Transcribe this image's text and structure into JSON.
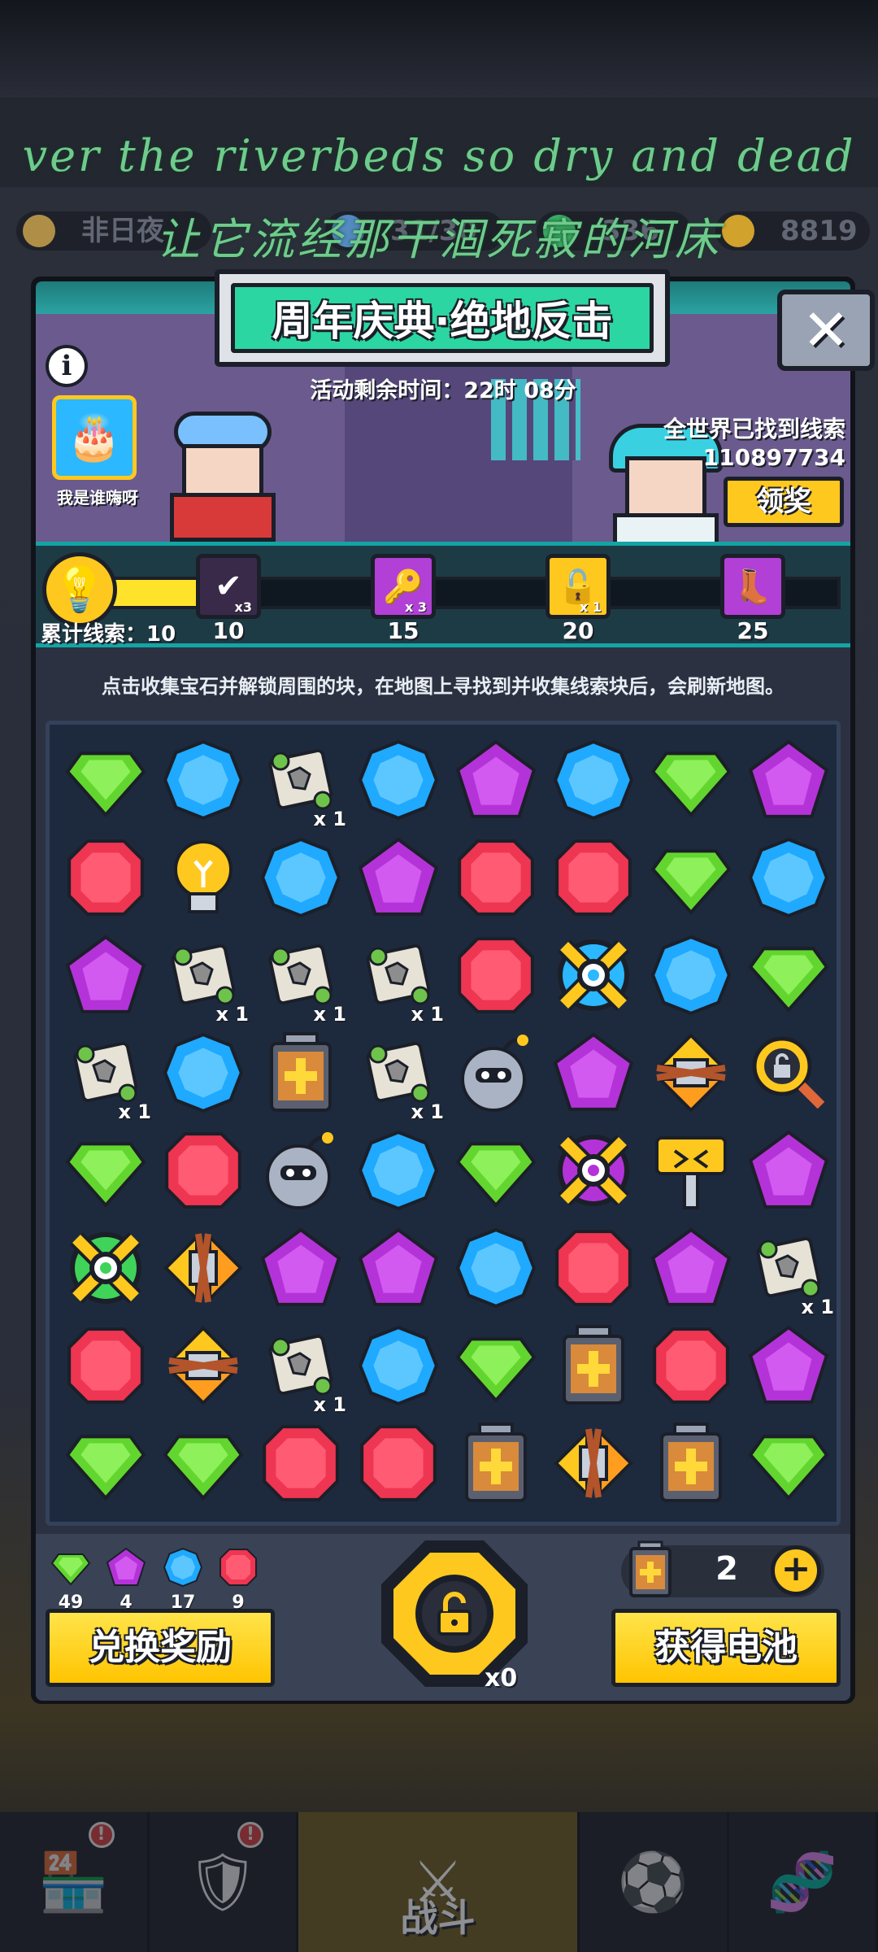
{
  "background": {
    "top_pills": [
      {
        "label": "非日夜",
        "color": "#c8a14a"
      },
      {
        "label": "31/30",
        "color": "#5b9bd8"
      },
      {
        "label": "336",
        "color": "#3cc26a"
      },
      {
        "label": "8819",
        "color": "#f0b82a"
      }
    ]
  },
  "lyrics": {
    "english": "ver the riverbeds so dry and dead",
    "chinese": "让它流经那干涸死寂的河床"
  },
  "event": {
    "title": "周年庆典·绝地反击",
    "close_glyph": "✕",
    "timer": "活动剩余时间：22时 08分",
    "info_glyph": "i",
    "avatar_name": "我是谁嗨呀",
    "world_found_label": "全世界已找到线索",
    "world_found_count": "110897734",
    "claim_button": "领奖"
  },
  "progress": {
    "clue_total_label": "累计线索：10",
    "fill_fraction": 0.19,
    "milestones": [
      {
        "label": "10",
        "icon": "check-icon",
        "multiplier": "x3",
        "color": "#3a2a4a",
        "glyph": "✔"
      },
      {
        "label": "15",
        "icon": "key-icon",
        "multiplier": "x 3",
        "color": "#b23fd6",
        "glyph": "🔑"
      },
      {
        "label": "20",
        "icon": "lock-icon",
        "multiplier": "x 1",
        "color": "#ffc81e",
        "glyph": "🔓"
      },
      {
        "label": "25",
        "icon": "boot-icon",
        "multiplier": "",
        "color": "#b23fd6",
        "glyph": "👢"
      }
    ]
  },
  "description": "点击收集宝石并解锁周围的块，在地图上寻找到并收集线索块后，会刷新地图。",
  "board": {
    "grid": [
      [
        "green",
        "blue",
        "puzzle:x 1",
        "blue",
        "purple",
        "blue",
        "green",
        "purple"
      ],
      [
        "red",
        "bulb",
        "blue",
        "purple",
        "red",
        "red",
        "green",
        "blue"
      ],
      [
        "purple",
        "puzzle:x 1",
        "puzzle:x 1",
        "puzzle:x 1",
        "red",
        "target-blue",
        "blue",
        "green"
      ],
      [
        "puzzle:x 1",
        "blue",
        "battery",
        "puzzle:x 1",
        "bomb",
        "purple",
        "arrows-v",
        "magnifier"
      ],
      [
        "green",
        "red",
        "bomb",
        "blue",
        "green",
        "target-purple",
        "hammer",
        "purple"
      ],
      [
        "target-green",
        "arrows-h",
        "purple",
        "purple",
        "blue",
        "red",
        "purple",
        "puzzle:x 1"
      ],
      [
        "red",
        "arrows-v",
        "puzzle:x 1",
        "blue",
        "green",
        "battery",
        "red",
        "purple"
      ],
      [
        "green",
        "green",
        "red",
        "red",
        "battery",
        "arrows-h",
        "battery",
        "green"
      ]
    ],
    "colors": {
      "green": "#62d62e",
      "blue": "#1fa9ff",
      "purple": "#b433d8",
      "red": "#ee3551"
    }
  },
  "footer": {
    "inventory": [
      {
        "gem": "green",
        "count": "49"
      },
      {
        "gem": "purple",
        "count": "4"
      },
      {
        "gem": "blue",
        "count": "17"
      },
      {
        "gem": "red",
        "count": "9"
      }
    ],
    "exchange_button": "兑换奖励",
    "unlock_count": "x0",
    "battery_count": "2",
    "battery_plus": "+",
    "get_battery_button": "获得电池"
  },
  "bottom_nav": {
    "items": [
      {
        "icon": "shop-icon",
        "glyph": "🏪",
        "badge": "!"
      },
      {
        "icon": "armor-icon",
        "glyph": "🛡",
        "badge": "!"
      },
      {
        "icon": "battle-icon",
        "glyph": "⚔",
        "label": "战斗"
      },
      {
        "icon": "ball-icon",
        "glyph": "⚽",
        "badge": ""
      },
      {
        "icon": "dna-icon",
        "glyph": "🧬",
        "badge": ""
      }
    ]
  }
}
